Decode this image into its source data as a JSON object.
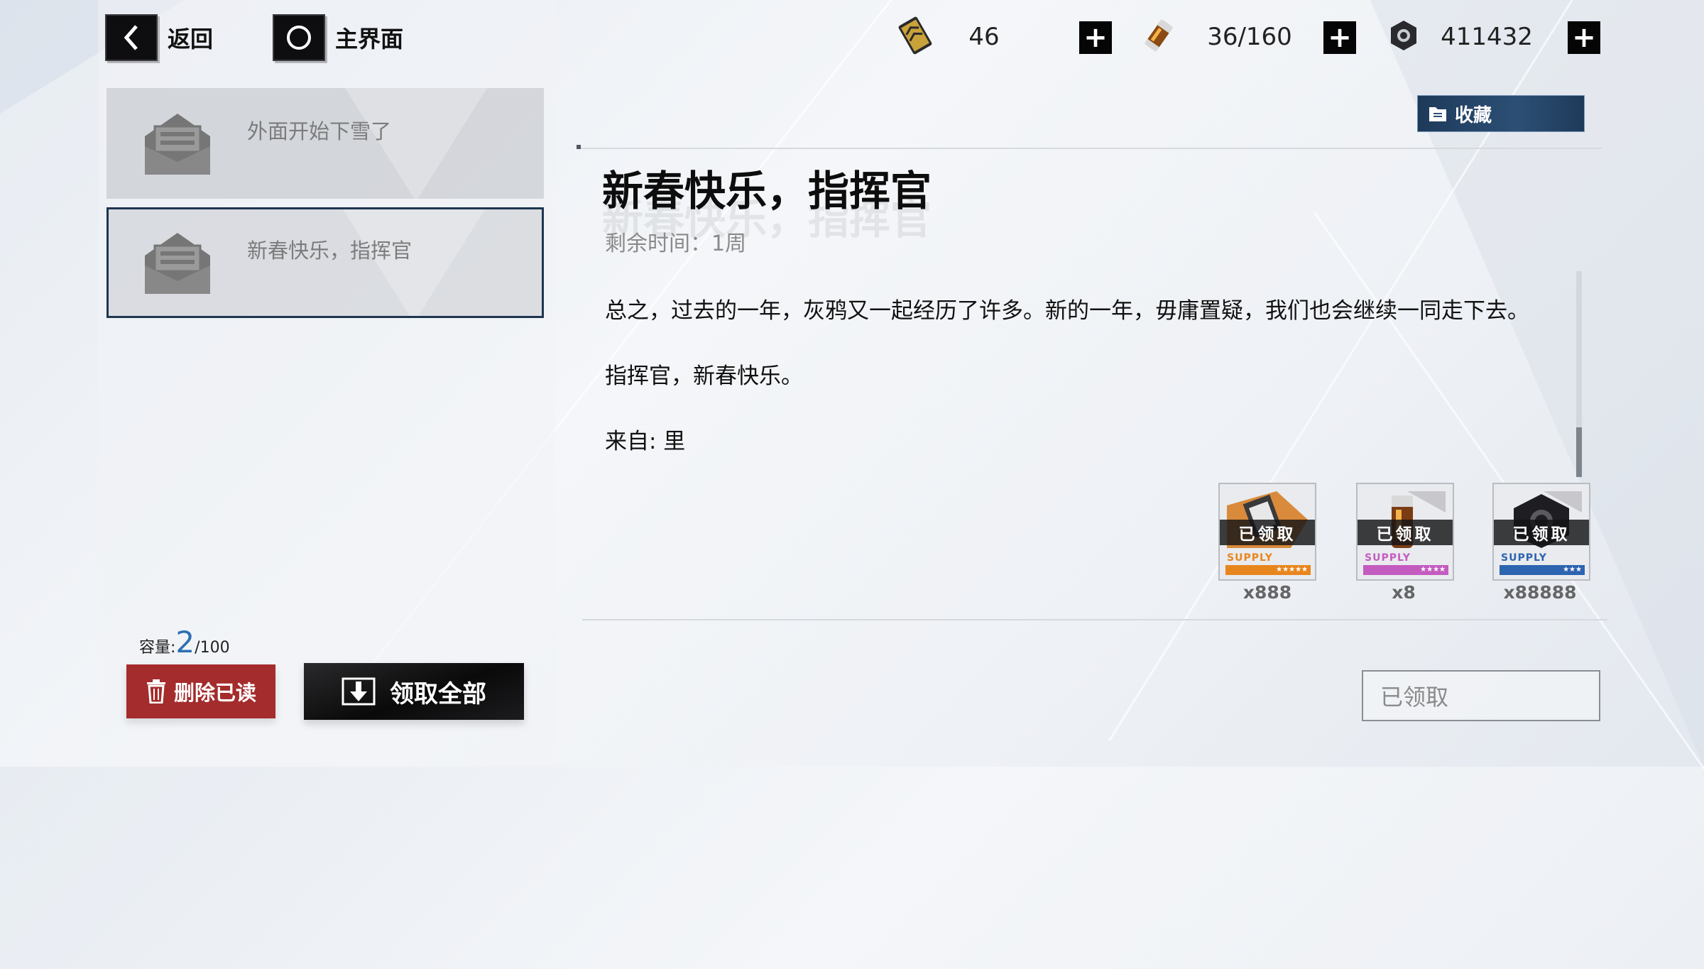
{
  "nav": {
    "back_label": "返回",
    "home_label": "主界面"
  },
  "resources": [
    {
      "icon": "ticket-icon",
      "value": "46"
    },
    {
      "icon": "battery-icon",
      "value": "36/160"
    },
    {
      "icon": "hex-nut-icon",
      "value": "411432"
    }
  ],
  "mail_list": [
    {
      "title": "外面开始下雪了",
      "selected": false
    },
    {
      "title": "新春快乐，指挥官",
      "selected": true
    }
  ],
  "mail": {
    "favorite_label": "收藏",
    "title": "新春快乐，指挥官",
    "remaining": "剩余时间：1周",
    "body": [
      "总之，过去的一年，灰鸦又一起经历了许多。新的一年，毋庸置疑，我们也会继续一同走下去。",
      "指挥官，新春快乐。",
      "来自: 里"
    ],
    "rewards": [
      {
        "claimed_label": "已领取",
        "supply_label": "SUPPLY",
        "stars": "★★★★★",
        "quantity": "x888",
        "color": "#e8861e"
      },
      {
        "claimed_label": "已领取",
        "supply_label": "SUPPLY",
        "stars": "★★★★",
        "quantity": "x8",
        "color": "#c45cc0"
      },
      {
        "claimed_label": "已领取",
        "supply_label": "SUPPLY",
        "stars": "★★★",
        "quantity": "x88888",
        "color": "#2d64b0"
      }
    ],
    "claimed_button_label": "已领取"
  },
  "footer": {
    "capacity_label": "容量:",
    "capacity_current": "2",
    "capacity_max": "/100",
    "delete_read_label": "删除已读",
    "claim_all_label": "领取全部"
  },
  "colors": {
    "delete_red": "#a42c2c",
    "favorite_blue": "#2c4f75",
    "selected_border": "#1e3550"
  }
}
